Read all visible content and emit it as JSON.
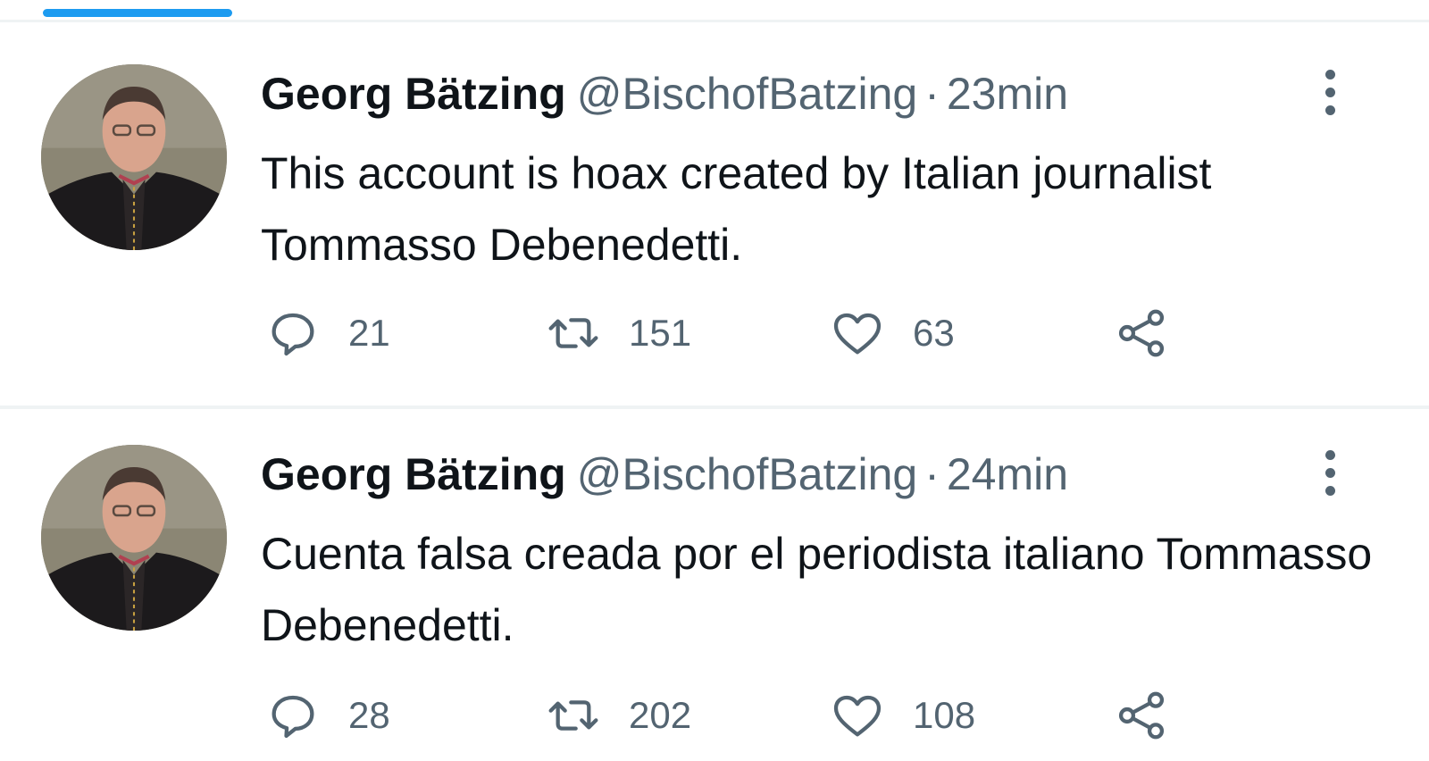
{
  "tweets": [
    {
      "name": "Georg Bätzing",
      "handle": "@BischofBatzing",
      "separator": "·",
      "time": "23min",
      "text": "This account is hoax created by Italian journalist Tommasso Debenedetti.",
      "replies": "21",
      "retweets": "151",
      "likes": "63"
    },
    {
      "name": "Georg Bätzing",
      "handle": "@BischofBatzing",
      "separator": "·",
      "time": "24min",
      "text": "Cuenta falsa creada por el periodista italiano Tommasso Debenedetti.",
      "replies": "28",
      "retweets": "202",
      "likes": "108"
    }
  ],
  "icons": {
    "reply": "reply-icon",
    "retweet": "retweet-icon",
    "like": "heart-icon",
    "share": "share-icon",
    "more": "more-options-icon"
  },
  "colors": {
    "accent": "#1d9bf0",
    "text": "#0f1419",
    "secondary": "#536471",
    "divider": "#eff3f4"
  }
}
